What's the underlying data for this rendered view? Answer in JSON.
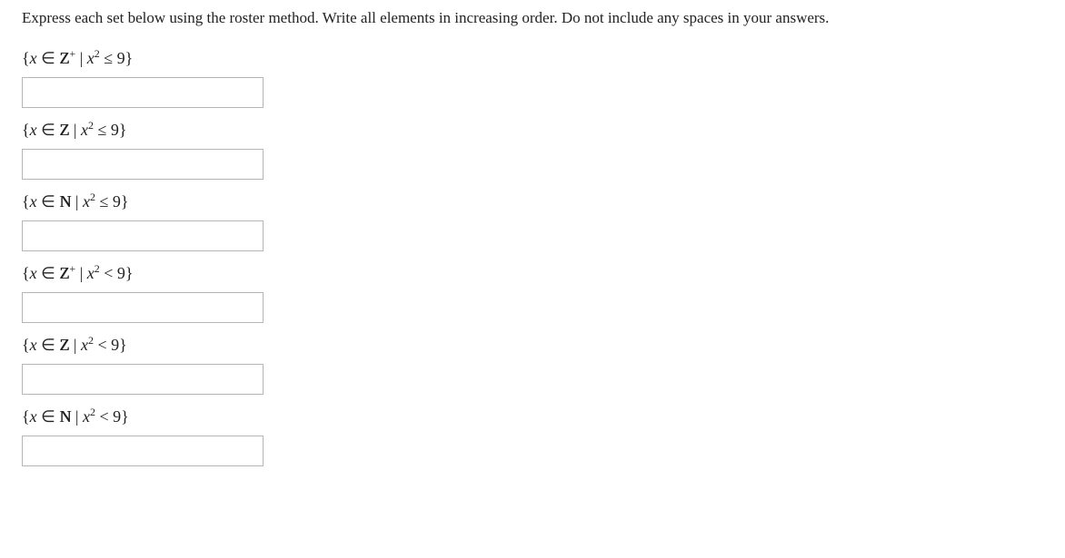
{
  "instruction": "Express each set below using the roster method. Write all elements in increasing order. Do not include any spaces in your answers.",
  "questions": [
    {
      "set": "Z+",
      "rel": "≤",
      "bound": "9",
      "value": ""
    },
    {
      "set": "Z",
      "rel": "≤",
      "bound": "9",
      "value": ""
    },
    {
      "set": "N",
      "rel": "≤",
      "bound": "9",
      "value": ""
    },
    {
      "set": "Z+",
      "rel": "<",
      "bound": "9",
      "value": ""
    },
    {
      "set": "Z",
      "rel": "<",
      "bound": "9",
      "value": ""
    },
    {
      "set": "N",
      "rel": "<",
      "bound": "9",
      "value": ""
    }
  ]
}
